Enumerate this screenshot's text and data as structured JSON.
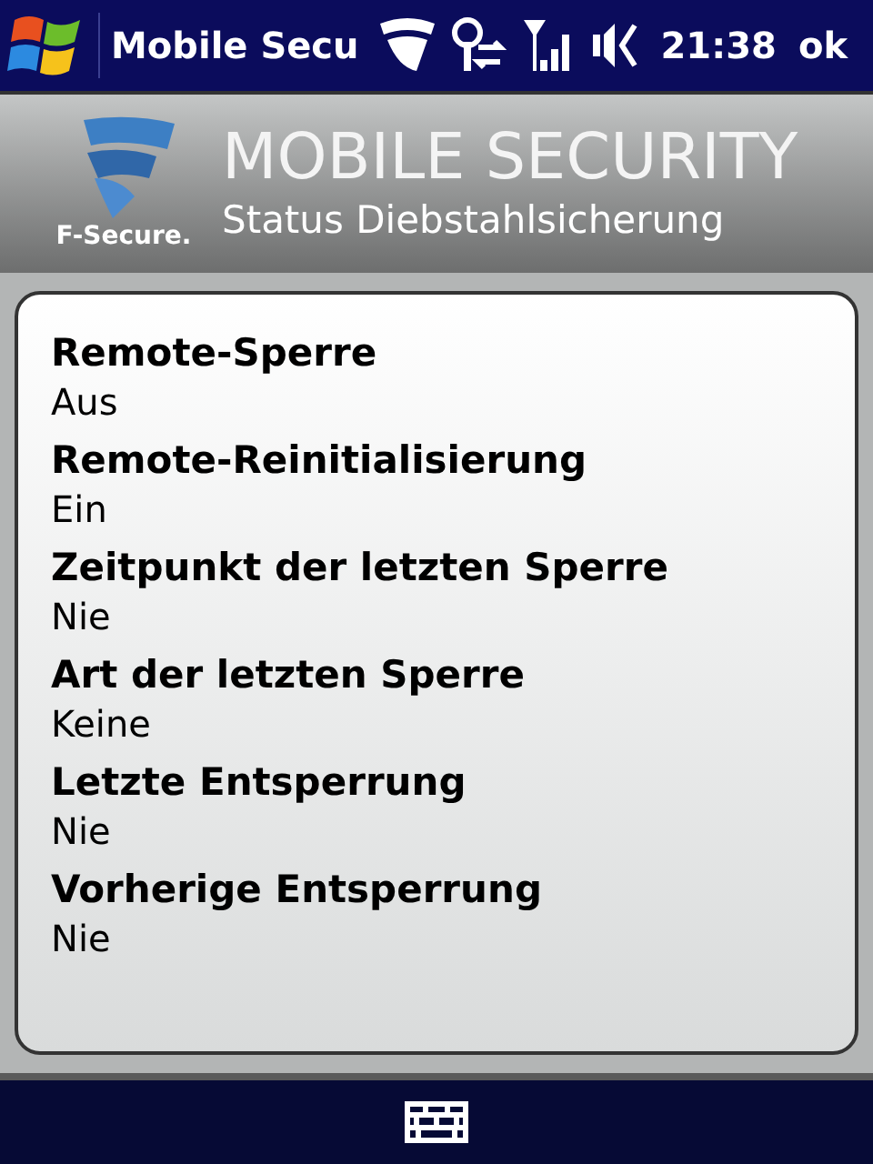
{
  "status_bar": {
    "title": "Mobile Secu",
    "time": "21:38",
    "ok": "ok"
  },
  "header": {
    "brand": "F-Secure.",
    "product": "MOBILE SECURITY",
    "subtitle": "Status Diebstahlsicherung"
  },
  "items": [
    {
      "label": "Remote-Sperre",
      "value": "Aus"
    },
    {
      "label": "Remote-Reinitialisierung",
      "value": "Ein"
    },
    {
      "label": "Zeitpunkt der letzten Sperre",
      "value": "Nie"
    },
    {
      "label": "Art der letzten Sperre",
      "value": "Keine"
    },
    {
      "label": "Letzte Entsperrung",
      "value": "Nie"
    },
    {
      "label": "Vorherige Entsperrung",
      "value": "Nie"
    }
  ]
}
